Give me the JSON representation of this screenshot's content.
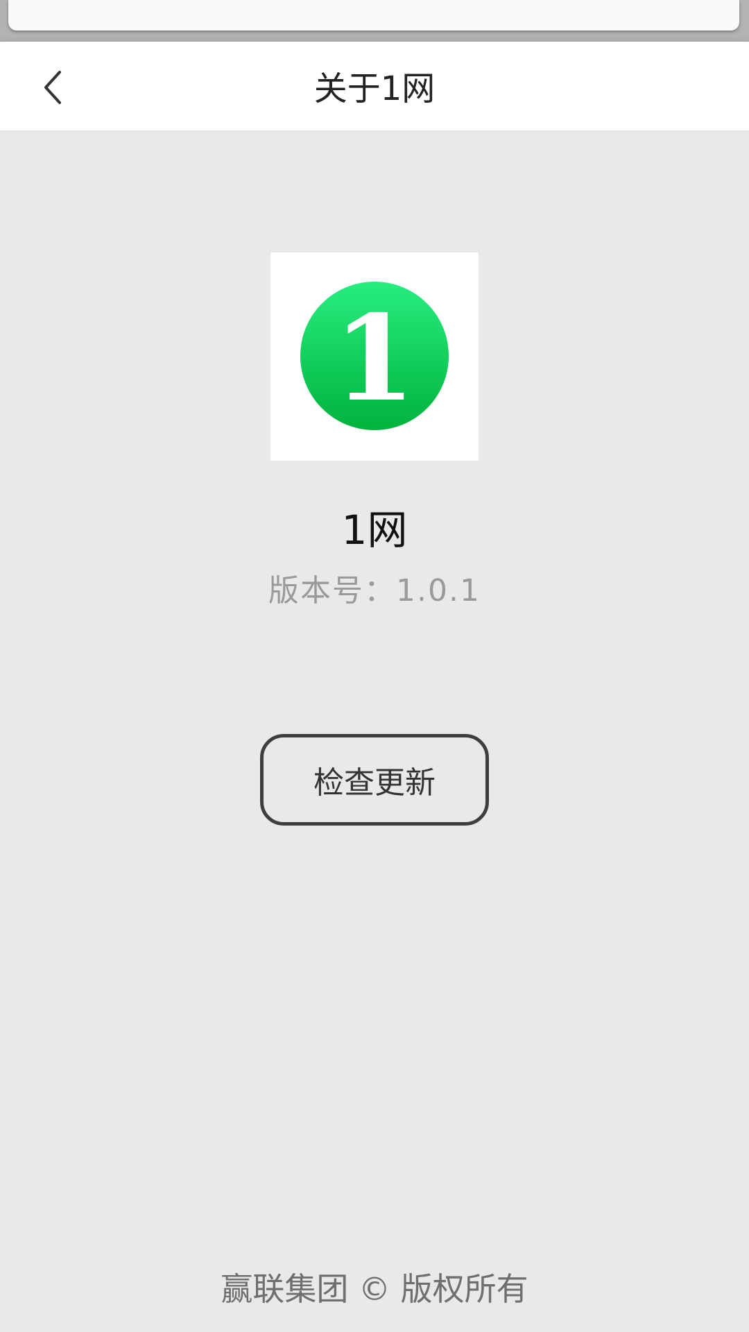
{
  "header": {
    "title": "关于1网",
    "back_icon": "chevron-left-icon"
  },
  "app": {
    "logo_glyph": "1",
    "name": "1网",
    "version_label": "版本号：",
    "version": "1.0.1",
    "logo_colors": {
      "top": "#27ee7f",
      "bottom": "#00b23c"
    }
  },
  "actions": {
    "check_update_label": "检查更新"
  },
  "footer": {
    "copyright": "赢联集团 © 版权所有"
  }
}
